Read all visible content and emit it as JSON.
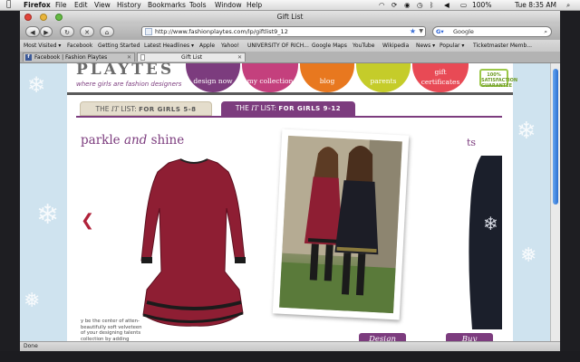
{
  "menubar": {
    "app_name": "Firefox",
    "items": [
      "File",
      "Edit",
      "View",
      "History",
      "Bookmarks",
      "Tools",
      "Window",
      "Help"
    ],
    "battery": "100%",
    "clock": "Tue 8:35 AM"
  },
  "window": {
    "title": "Gift List"
  },
  "toolbar": {
    "url": "http://www.fashionplaytes.com/lp/giftlist9_12",
    "search_placeholder": "Google"
  },
  "bookmarks": {
    "items": [
      "Most Visited ▾",
      "Facebook",
      "Getting Started",
      "Latest Headlines ▾",
      "Apple",
      "Yahoo!",
      "UNIVERSITY OF RICH...",
      "Google Maps",
      "YouTube",
      "Wikipedia",
      "News ▾",
      "Popular ▾",
      "Ticketmaster Memb..."
    ]
  },
  "tabs": [
    {
      "label": "Facebook | Fashion Playtes"
    },
    {
      "label": "Gift List"
    }
  ],
  "site": {
    "logo_text": "PLAYTES",
    "tagline": "where girls are fashion designers",
    "nav": [
      {
        "label": "design now",
        "color": "#7c3c7e"
      },
      {
        "label": "my collection",
        "color": "#c4407d"
      },
      {
        "label": "blog",
        "color": "#e8781f"
      },
      {
        "label": "parents",
        "color": "#c5cc2a"
      },
      {
        "label": "gift",
        "label2": "certificates",
        "color": "#e84a55"
      }
    ],
    "badge": [
      "100%",
      "SATISFACTION",
      "GUARANTEE"
    ],
    "accent": "#7c3c7e"
  },
  "it_tabs": [
    {
      "prefix": "THE",
      "it": "IT",
      "list": "LIST:",
      "for": "FOR GIRLS 5-8"
    },
    {
      "prefix": "THE",
      "it": "IT",
      "list": "LIST:",
      "for": "FOR GIRLS 9-12"
    }
  ],
  "carousel": {
    "headline_start": "parkle ",
    "headline_and": "and",
    "headline_end": " shine",
    "headline_next": "ts",
    "description": "y be the center of atten- beautifully soft velveteen of your designing talents  collection by adding",
    "arrow_left": "❮",
    "arrow_right": "❯",
    "design_button": "Design",
    "buy_button": "Buy"
  },
  "status": {
    "text": "Done"
  }
}
